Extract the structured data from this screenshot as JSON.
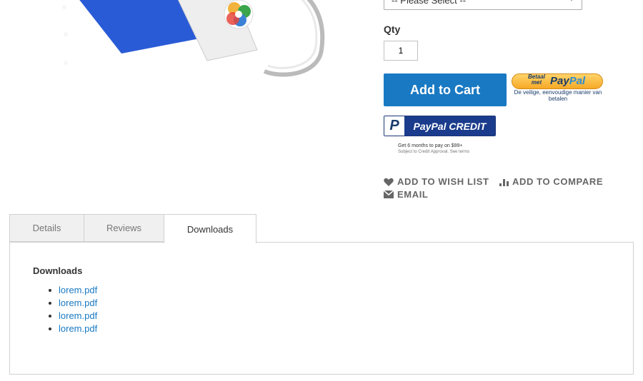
{
  "product_image": {
    "alt": ""
  },
  "options": {
    "selected": "-- Please Select --"
  },
  "qty": {
    "label": "Qty",
    "value": "1"
  },
  "add_to_cart": {
    "label": "Add to Cart",
    "color": "#1979c3"
  },
  "paypal_express": {
    "top_text": "Betaal met",
    "brand_pay": "Pay",
    "brand_pal": "Pal",
    "tagline": "De veilige, eenvoudige manier van betalen"
  },
  "paypal_credit": {
    "label": "PayPal CREDIT",
    "note": "Get 6 months to pay on $99+",
    "subnote": "Subject to Credit Approval. See terms"
  },
  "actions": {
    "wishlist": "ADD TO WISH LIST",
    "compare": "ADD TO COMPARE",
    "email": "EMAIL"
  },
  "tabs": [
    {
      "label": "Details",
      "active": false
    },
    {
      "label": "Reviews",
      "active": false
    },
    {
      "label": "Downloads",
      "active": true
    }
  ],
  "downloads": {
    "title": "Downloads",
    "files": [
      "lorem.pdf",
      "lorem.pdf",
      "lorem.pdf",
      "lorem.pdf"
    ]
  }
}
